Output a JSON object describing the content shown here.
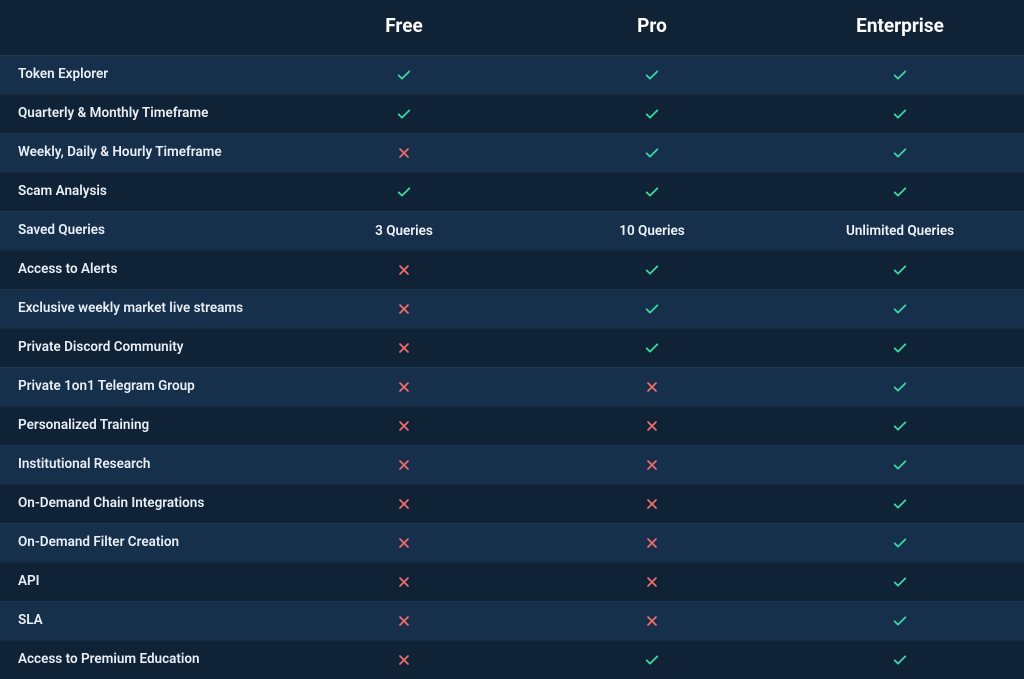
{
  "plans": [
    "Free",
    "Pro",
    "Enterprise"
  ],
  "colors": {
    "check": "#3dd9a4",
    "cross": "#f16c6c",
    "row_alt": "#16304b",
    "bg": "#0f2236"
  },
  "rows": [
    {
      "label": "Token Explorer",
      "cells": [
        "check",
        "check",
        "check"
      ],
      "alt": true
    },
    {
      "label": "Quarterly & Monthly Timeframe",
      "cells": [
        "check",
        "check",
        "check"
      ],
      "alt": false
    },
    {
      "label": "Weekly, Daily & Hourly Timeframe",
      "cells": [
        "cross",
        "check",
        "check"
      ],
      "alt": true
    },
    {
      "label": "Scam Analysis",
      "cells": [
        "check",
        "check",
        "check"
      ],
      "alt": false
    },
    {
      "label": "Saved Queries",
      "cells": [
        "3 Queries",
        "10 Queries",
        "Unlimited Queries"
      ],
      "alt": true
    },
    {
      "label": "Access to Alerts",
      "cells": [
        "cross",
        "check",
        "check"
      ],
      "alt": false
    },
    {
      "label": "Exclusive weekly market live streams",
      "cells": [
        "cross",
        "check",
        "check"
      ],
      "alt": true
    },
    {
      "label": "Private Discord Community",
      "cells": [
        "cross",
        "check",
        "check"
      ],
      "alt": false
    },
    {
      "label": "Private 1on1 Telegram Group",
      "cells": [
        "cross",
        "cross",
        "check"
      ],
      "alt": true
    },
    {
      "label": "Personalized Training",
      "cells": [
        "cross",
        "cross",
        "check"
      ],
      "alt": false
    },
    {
      "label": "Institutional Research",
      "cells": [
        "cross",
        "cross",
        "check"
      ],
      "alt": true
    },
    {
      "label": "On-Demand Chain Integrations",
      "cells": [
        "cross",
        "cross",
        "check"
      ],
      "alt": false
    },
    {
      "label": "On-Demand Filter Creation",
      "cells": [
        "cross",
        "cross",
        "check"
      ],
      "alt": true
    },
    {
      "label": "API",
      "cells": [
        "cross",
        "cross",
        "check"
      ],
      "alt": false
    },
    {
      "label": "SLA",
      "cells": [
        "cross",
        "cross",
        "check"
      ],
      "alt": true
    },
    {
      "label": "Access to Premium Education",
      "cells": [
        "cross",
        "check",
        "check"
      ],
      "alt": false
    }
  ]
}
